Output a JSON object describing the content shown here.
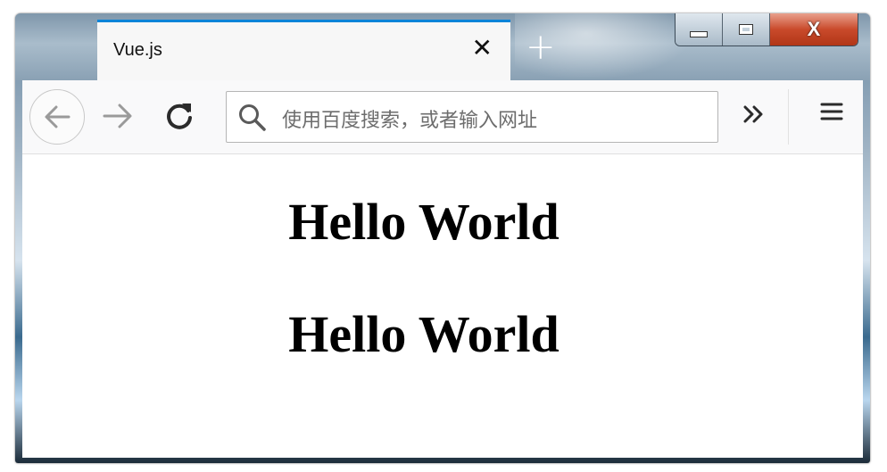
{
  "browser": {
    "tab": {
      "title": "Vue.js"
    },
    "window_controls": {
      "close_label": "X"
    },
    "toolbar": {
      "url_placeholder": "使用百度搜索，或者输入网址"
    }
  },
  "page": {
    "headings": [
      "Hello World",
      "Hello World"
    ]
  },
  "colors": {
    "tab_accent": "#0a84d8",
    "close_button": "#c94a2b"
  },
  "icons": [
    "back-arrow-icon",
    "forward-arrow-icon",
    "reload-icon",
    "search-icon",
    "overflow-chevron-icon",
    "hamburger-menu-icon",
    "close-tab-icon",
    "new-tab-plus-icon"
  ]
}
